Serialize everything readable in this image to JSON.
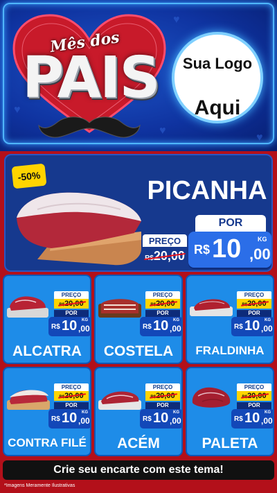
{
  "header": {
    "script_title": "Mês dos",
    "main_title": "PAIS",
    "logo_line1": "Sua Logo",
    "logo_line2": "Aqui"
  },
  "featured": {
    "discount": "-50%",
    "name": "PICANHA",
    "old_label": "PREÇO",
    "old_currency": "R$",
    "old_price": "20,00",
    "por_label": "POR",
    "currency": "R$",
    "price_int": "10",
    "price_dec": ",00",
    "unit": "KG",
    "image_icon": "picanha-meat-image"
  },
  "products": [
    {
      "name": "ALCATRA",
      "old_label": "PREÇO",
      "old_currency": "R$",
      "old_price": "20,00",
      "por_label": "POR",
      "currency": "R$",
      "price_int": "10",
      "price_dec": ",00",
      "unit": "KG"
    },
    {
      "name": "COSTELA",
      "old_label": "PREÇO",
      "old_currency": "R$",
      "old_price": "20,00",
      "por_label": "POR",
      "currency": "R$",
      "price_int": "10",
      "price_dec": ",00",
      "unit": "KG"
    },
    {
      "name": "FRALDINHA",
      "old_label": "PREÇO",
      "old_currency": "R$",
      "old_price": "20,00",
      "por_label": "POR",
      "currency": "R$",
      "price_int": "10",
      "price_dec": ",00",
      "unit": "KG"
    },
    {
      "name": "CONTRA FILÉ",
      "old_label": "PREÇO",
      "old_currency": "R$",
      "old_price": "20,00",
      "por_label": "POR",
      "currency": "R$",
      "price_int": "10",
      "price_dec": ",00",
      "unit": "KG"
    },
    {
      "name": "ACÉM",
      "old_label": "PREÇO",
      "old_currency": "R$",
      "old_price": "20,00",
      "por_label": "POR",
      "currency": "R$",
      "price_int": "10",
      "price_dec": ",00",
      "unit": "KG"
    },
    {
      "name": "PALETA",
      "old_label": "PREÇO",
      "old_currency": "R$",
      "old_price": "20,00",
      "por_label": "POR",
      "currency": "R$",
      "price_int": "10",
      "price_dec": ",00",
      "unit": "KG"
    }
  ],
  "footer": {
    "cta": "Crie seu encarte com este tema!",
    "disclaimer": "*Imagens Meramente Ilustrativas"
  },
  "colors": {
    "background_red": "#b3101a",
    "header_blue": "#0f33a0",
    "card_blue": "#1e8ce8",
    "price_yellow": "#ffd400",
    "strike_red": "#e5101a"
  }
}
